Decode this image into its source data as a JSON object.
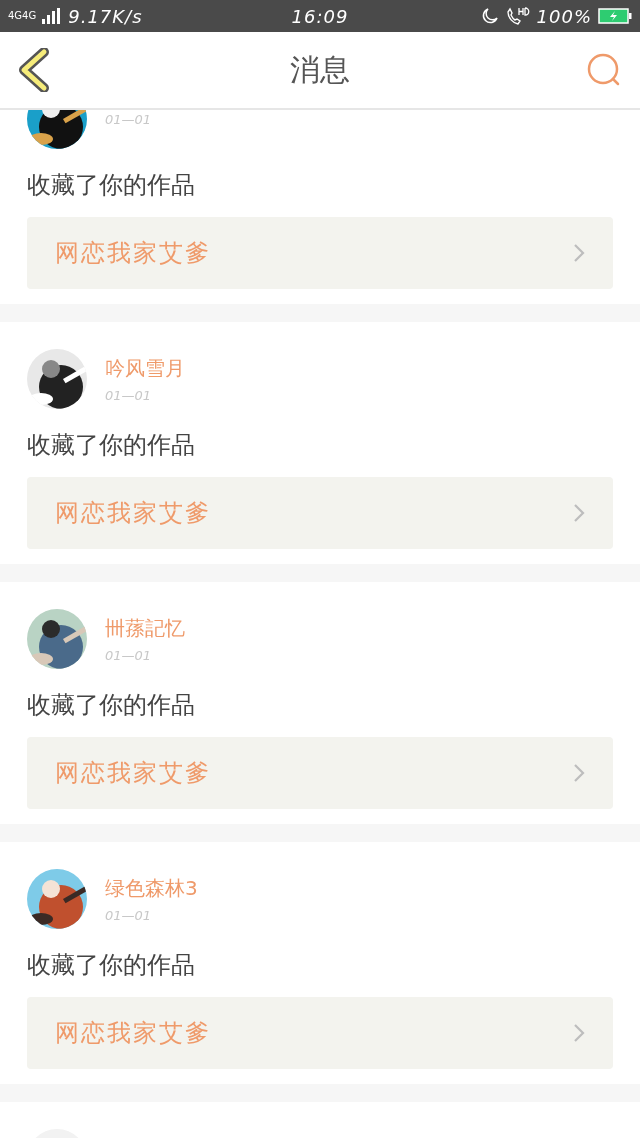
{
  "status_bar": {
    "network": "4G4G",
    "speed": "9.17K/s",
    "time": "16:09",
    "battery": "100%"
  },
  "header": {
    "title": "消息"
  },
  "cards": [
    {
      "avatar": {
        "kind": "picture"
      },
      "date": "01—01",
      "action": "收藏了你的作品",
      "work": "网恋我家艾爹"
    },
    {
      "avatar": {
        "kind": "picture"
      },
      "username": "吟风雪月",
      "date": "01—01",
      "action": "收藏了你的作品",
      "work": "网恋我家艾爹"
    },
    {
      "avatar": {
        "kind": "picture"
      },
      "username": "卌蓀記忆",
      "date": "01—01",
      "action": "收藏了你的作品",
      "work": "网恋我家艾爹"
    },
    {
      "avatar": {
        "kind": "picture"
      },
      "username": "绿色森林3",
      "date": "01—01",
      "action": "收藏了你的作品",
      "work": "网恋我家艾爹"
    },
    {
      "avatar": {
        "kind": "picture"
      }
    }
  ]
}
